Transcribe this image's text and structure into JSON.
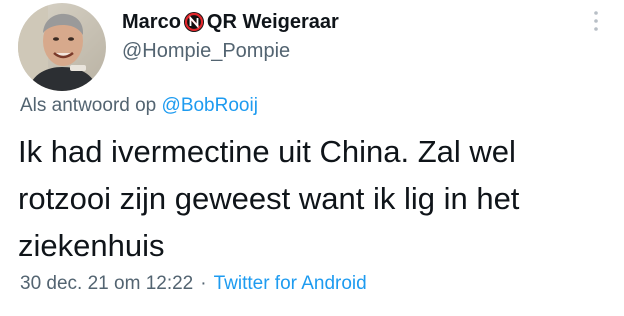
{
  "author": {
    "name_first": "Marco",
    "name_emoji": "no-entry-letter-n-emoji",
    "name_rest": "QR Weigeraar",
    "handle": "@Hompie_Pompie"
  },
  "reply": {
    "prefix": "Als antwoord op",
    "mention": "@BobRooij"
  },
  "tweet": {
    "text": "Ik had ivermectine uit China. Zal wel rotzooi zijn geweest want ik lig in het ziekenhuis"
  },
  "meta": {
    "timestamp": "30 dec. 21 om 12:22",
    "separator": "·",
    "source": "Twitter for Android"
  },
  "colors": {
    "text": "#0f1419",
    "secondary": "#536471",
    "link": "#1d9bf0",
    "emoji_red": "#e0262b"
  }
}
